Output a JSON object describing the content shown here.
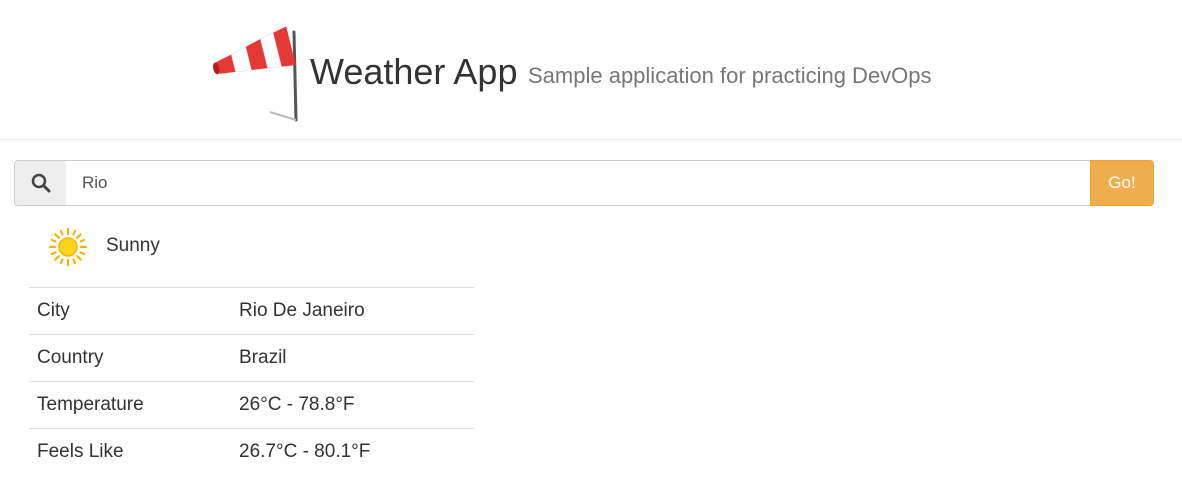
{
  "header": {
    "title": "Weather App",
    "subtitle": "Sample application for practicing DevOps",
    "logo_icon": "windsock-icon"
  },
  "search": {
    "icon": "search-icon",
    "value": "Rio",
    "button_label": "Go!",
    "button_color": "#f0ad4e"
  },
  "result": {
    "condition_icon": "sun-icon",
    "condition": "Sunny",
    "rows": [
      {
        "label": "City",
        "value": "Rio De Janeiro"
      },
      {
        "label": "Country",
        "value": "Brazil"
      },
      {
        "label": "Temperature",
        "value": "26°C - 78.8°F"
      },
      {
        "label": "Feels Like",
        "value": "26.7°C - 80.1°F"
      }
    ]
  }
}
